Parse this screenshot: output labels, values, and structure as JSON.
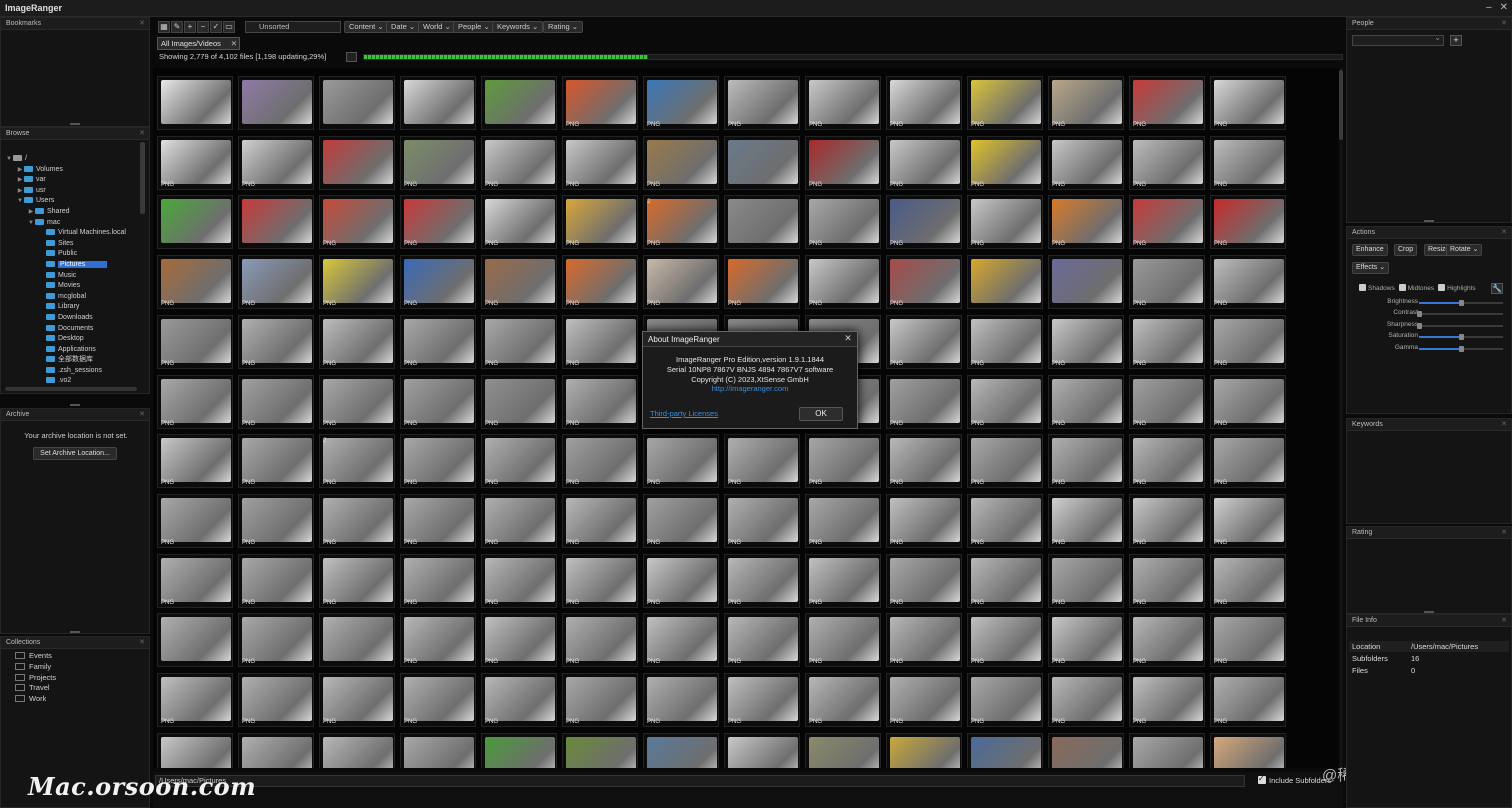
{
  "app": {
    "title": "ImageRanger"
  },
  "panels": {
    "bookmarks": "Bookmarks",
    "browse": "Browse",
    "archive": "Archive",
    "collections": "Collections",
    "people": "People",
    "actions": "Actions",
    "keywords": "Keywords",
    "rating": "Rating",
    "file_info": "File Info"
  },
  "tree": [
    {
      "label": "/",
      "depth": 0,
      "expanded": true,
      "drive": true
    },
    {
      "label": "Volumes",
      "depth": 1,
      "expanded": false
    },
    {
      "label": "var",
      "depth": 1,
      "expanded": false
    },
    {
      "label": "usr",
      "depth": 1,
      "expanded": false
    },
    {
      "label": "Users",
      "depth": 1,
      "expanded": true
    },
    {
      "label": "Shared",
      "depth": 2,
      "expanded": false
    },
    {
      "label": "mac",
      "depth": 2,
      "expanded": true
    },
    {
      "label": "Virtual Machines.local",
      "depth": 3
    },
    {
      "label": "Sites",
      "depth": 3
    },
    {
      "label": "Public",
      "depth": 3
    },
    {
      "label": "Pictures",
      "depth": 3,
      "selected": true
    },
    {
      "label": "Music",
      "depth": 3
    },
    {
      "label": "Movies",
      "depth": 3
    },
    {
      "label": "mcglobal",
      "depth": 3
    },
    {
      "label": "Library",
      "depth": 3
    },
    {
      "label": "Downloads",
      "depth": 3
    },
    {
      "label": "Documents",
      "depth": 3
    },
    {
      "label": "Desktop",
      "depth": 3
    },
    {
      "label": "Applications",
      "depth": 3
    },
    {
      "label": "全部数据库",
      "depth": 3
    },
    {
      "label": ".zsh_sessions",
      "depth": 3
    },
    {
      "label": ".vo2",
      "depth": 3
    }
  ],
  "archive": {
    "message": "Your archive location is not set.",
    "button": "Set Archive Location..."
  },
  "collections": [
    "Events",
    "Family",
    "Projects",
    "Travel",
    "Work"
  ],
  "toolbar": {
    "sort_value": "Unsorted",
    "filters": [
      "Content",
      "Date",
      "World",
      "People",
      "Keywords",
      "Rating"
    ],
    "tab_label": "All Images/Videos",
    "status": "Showing 2,779 of 4,102 files [1,198 updating,29%]",
    "progress": 0.29
  },
  "grid": {
    "rows": [
      [
        {
          "tag": "",
          "c": "#e8e8e8"
        },
        {
          "tag": "",
          "c": "#8e7aa6"
        },
        {
          "tag": "",
          "c": "#9a9a9a"
        },
        {
          "tag": "",
          "c": "#d8d8d8"
        },
        {
          "tag": "",
          "c": "#5e9a3c"
        },
        {
          "tag": "PNG",
          "c": "#d8572a"
        },
        {
          "tag": "PNG",
          "c": "#3a78b8"
        },
        {
          "tag": "PNG",
          "c": "#bdbdbd"
        },
        {
          "tag": "PNG",
          "c": "#c9c9c9"
        },
        {
          "tag": "PNG",
          "c": "#d8d8d8"
        },
        {
          "tag": "PNG",
          "c": "#d9c43a"
        },
        {
          "tag": "PNG",
          "c": "#b8a78a"
        },
        {
          "tag": "PNG",
          "c": "#c83a3a"
        },
        {
          "tag": "PNG",
          "c": "#d8d8d8"
        }
      ],
      [
        {
          "tag": "PNG",
          "c": "#e0e0e0"
        },
        {
          "tag": "PNG",
          "c": "#d0d0d0"
        },
        {
          "tag": "",
          "c": "#c23b3b"
        },
        {
          "tag": "PNG",
          "c": "#7c8c6a"
        },
        {
          "tag": "PNG",
          "c": "#c8c8c8"
        },
        {
          "tag": "PNG",
          "c": "#c8c8c8"
        },
        {
          "tag": "PNG",
          "c": "#9a7a4a"
        },
        {
          "tag": "",
          "c": "#6a7a8c"
        },
        {
          "tag": "PNG",
          "c": "#a82a2a"
        },
        {
          "tag": "PNG",
          "c": "#c8c8c8"
        },
        {
          "tag": "PNG",
          "c": "#e0c22a"
        },
        {
          "tag": "PNG",
          "c": "#c8c8c8"
        },
        {
          "tag": "PNG",
          "c": "#bdbdbd"
        },
        {
          "tag": "PNG",
          "c": "#bdbdbd"
        }
      ],
      [
        {
          "tag": "",
          "c": "#4aa83a"
        },
        {
          "tag": "",
          "c": "#c83a3a"
        },
        {
          "tag": "PNG",
          "c": "#c84a3a"
        },
        {
          "tag": "PNG",
          "c": "#c83a3a"
        },
        {
          "tag": "PNG",
          "c": "#d8d8d8"
        },
        {
          "tag": "PNG",
          "c": "#d8a83a"
        },
        {
          "tag": "PNG",
          "c": "#d86a2a",
          "ct": "2"
        },
        {
          "tag": "",
          "c": "#8a8a8a"
        },
        {
          "tag": "PNG",
          "c": "#a8a8a8"
        },
        {
          "tag": "PNG",
          "c": "#4a5a8a"
        },
        {
          "tag": "PNG",
          "c": "#c8c8c8"
        },
        {
          "tag": "PNG",
          "c": "#d87a2a"
        },
        {
          "tag": "PNG",
          "c": "#c83a3a"
        },
        {
          "tag": "PNG",
          "c": "#c82a2a"
        }
      ],
      [
        {
          "tag": "PNG",
          "c": "#a86a3a"
        },
        {
          "tag": "PNG",
          "c": "#8a9ab8"
        },
        {
          "tag": "PNG",
          "c": "#d8c83a"
        },
        {
          "tag": "PNG",
          "c": "#3a6ab8"
        },
        {
          "tag": "PNG",
          "c": "#9a6a4a"
        },
        {
          "tag": "PNG",
          "c": "#d86a2a"
        },
        {
          "tag": "PNG",
          "c": "#c8b8a8"
        },
        {
          "tag": "PNG",
          "c": "#d86a2a"
        },
        {
          "tag": "PNG",
          "c": "#c8c8c8"
        },
        {
          "tag": "PNG",
          "c": "#a84a4a"
        },
        {
          "tag": "",
          "c": "#d8a82a"
        },
        {
          "tag": "",
          "c": "#6a6a9a"
        },
        {
          "tag": "PNG",
          "c": "#9a9a9a"
        },
        {
          "tag": "PNG",
          "c": "#bdbdbd"
        }
      ],
      [
        {
          "tag": "PNG",
          "c": "#9a9a9a"
        },
        {
          "tag": "PNG",
          "c": "#b0b0b0"
        },
        {
          "tag": "PNG",
          "c": "#bdbdbd"
        },
        {
          "tag": "PNG",
          "c": "#a8a8a8"
        },
        {
          "tag": "PNG",
          "c": "#a8a8a8"
        },
        {
          "tag": "PNG",
          "c": "#c0c0c0"
        },
        {
          "tag": "",
          "c": "#8a8a8a"
        },
        {
          "tag": "",
          "c": "#8a8a8a"
        },
        {
          "tag": "",
          "c": "#8a8a8a"
        },
        {
          "tag": "PNG",
          "c": "#c8c8c8"
        },
        {
          "tag": "PNG",
          "c": "#c0c0c0"
        },
        {
          "tag": "PNG",
          "c": "#c8c8c8"
        },
        {
          "tag": "PNG",
          "c": "#c0c0c0"
        },
        {
          "tag": "PNG",
          "c": "#a8a8a8"
        }
      ],
      [
        {
          "tag": "PNG",
          "c": "#a8a8a8"
        },
        {
          "tag": "PNG",
          "c": "#a0a0a0"
        },
        {
          "tag": "PNG",
          "c": "#a8a8a8"
        },
        {
          "tag": "PNG",
          "c": "#a0a0a0"
        },
        {
          "tag": "PNG",
          "c": "#909090"
        },
        {
          "tag": "PNG",
          "c": "#b0b0b0"
        },
        {
          "tag": "",
          "c": "#8a8a8a"
        },
        {
          "tag": "",
          "c": "#8a8a8a"
        },
        {
          "tag": "",
          "c": "#8a8a8a"
        },
        {
          "tag": "PNG",
          "c": "#a0a0a0"
        },
        {
          "tag": "PNG",
          "c": "#b8b8b8"
        },
        {
          "tag": "PNG",
          "c": "#b0b0b0"
        },
        {
          "tag": "PNG",
          "c": "#a0a0a0"
        },
        {
          "tag": "PNG",
          "c": "#a8a8a8"
        }
      ],
      [
        {
          "tag": "PNG",
          "c": "#c8c8c8"
        },
        {
          "tag": "PNG",
          "c": "#a8a8a8"
        },
        {
          "tag": "PNG",
          "c": "#b0b0b0",
          "ct": "2"
        },
        {
          "tag": "PNG",
          "c": "#a8a8a8"
        },
        {
          "tag": "PNG",
          "c": "#b0b0b0"
        },
        {
          "tag": "PNG",
          "c": "#a0a0a0"
        },
        {
          "tag": "PNG",
          "c": "#a8a8a8"
        },
        {
          "tag": "PNG",
          "c": "#b0b0b0"
        },
        {
          "tag": "PNG",
          "c": "#a8a8a8"
        },
        {
          "tag": "PNG",
          "c": "#b8b8b8"
        },
        {
          "tag": "PNG",
          "c": "#a8a8a8"
        },
        {
          "tag": "PNG",
          "c": "#b0b0b0"
        },
        {
          "tag": "PNG",
          "c": "#b8b8b8"
        },
        {
          "tag": "PNG",
          "c": "#a8a8a8"
        }
      ],
      [
        {
          "tag": "PNG",
          "c": "#a8a8a8"
        },
        {
          "tag": "PNG",
          "c": "#a0a0a0"
        },
        {
          "tag": "PNG",
          "c": "#b0b0b0"
        },
        {
          "tag": "PNG",
          "c": "#a8a8a8"
        },
        {
          "tag": "PNG",
          "c": "#b0b0b0"
        },
        {
          "tag": "PNG",
          "c": "#b8b8b8"
        },
        {
          "tag": "PNG",
          "c": "#a0a0a0"
        },
        {
          "tag": "PNG",
          "c": "#b0b0b0"
        },
        {
          "tag": "PNG",
          "c": "#a8a8a8"
        },
        {
          "tag": "PNG",
          "c": "#c0c0c0"
        },
        {
          "tag": "PNG",
          "c": "#b8b8b8"
        },
        {
          "tag": "PNG",
          "c": "#d0d0d0"
        },
        {
          "tag": "PNG",
          "c": "#c8c8c8"
        },
        {
          "tag": "PNG",
          "c": "#d0d0d0"
        }
      ],
      [
        {
          "tag": "PNG",
          "c": "#b0b0b0"
        },
        {
          "tag": "PNG",
          "c": "#a8a8a8"
        },
        {
          "tag": "PNG",
          "c": "#c0c0c0"
        },
        {
          "tag": "PNG",
          "c": "#b0b0b0"
        },
        {
          "tag": "PNG",
          "c": "#b8b8b8"
        },
        {
          "tag": "PNG",
          "c": "#c0c0c0"
        },
        {
          "tag": "PNG",
          "c": "#c8c8c8"
        },
        {
          "tag": "PNG",
          "c": "#b8b8b8"
        },
        {
          "tag": "PNG",
          "c": "#c0c0c0"
        },
        {
          "tag": "PNG",
          "c": "#a8a8a8"
        },
        {
          "tag": "PNG",
          "c": "#b8b8b8"
        },
        {
          "tag": "PNG",
          "c": "#a8a8a8"
        },
        {
          "tag": "PNG",
          "c": "#b0b0b0"
        },
        {
          "tag": "PNG",
          "c": "#b8b8b8"
        }
      ],
      [
        {
          "tag": "",
          "c": "#b0b0b0"
        },
        {
          "tag": "PNG",
          "c": "#a8a8a8"
        },
        {
          "tag": "",
          "c": "#b0b0b0"
        },
        {
          "tag": "PNG",
          "c": "#b8b8b8"
        },
        {
          "tag": "PNG",
          "c": "#c0c0c0"
        },
        {
          "tag": "PNG",
          "c": "#b0b0b0"
        },
        {
          "tag": "PNG",
          "c": "#c0c0c0"
        },
        {
          "tag": "PNG",
          "c": "#b8b8b8"
        },
        {
          "tag": "PNG",
          "c": "#b0b0b0"
        },
        {
          "tag": "PNG",
          "c": "#b8b8b8"
        },
        {
          "tag": "PNG",
          "c": "#c0c0c0"
        },
        {
          "tag": "PNG",
          "c": "#c8c8c8"
        },
        {
          "tag": "PNG",
          "c": "#b8b8b8"
        },
        {
          "tag": "PNG",
          "c": "#a8a8a8"
        }
      ],
      [
        {
          "tag": "PNG",
          "c": "#c0c0c0"
        },
        {
          "tag": "PNG",
          "c": "#b0b0b0"
        },
        {
          "tag": "PNG",
          "c": "#b8b8b8"
        },
        {
          "tag": "PNG",
          "c": "#b0b0b0"
        },
        {
          "tag": "PNG",
          "c": "#b8b8b8"
        },
        {
          "tag": "PNG",
          "c": "#a8a8a8"
        },
        {
          "tag": "PNG",
          "c": "#b0b0b0"
        },
        {
          "tag": "PNG",
          "c": "#c0c0c0"
        },
        {
          "tag": "PNG",
          "c": "#b8b8b8"
        },
        {
          "tag": "PNG",
          "c": "#b0b0b0"
        },
        {
          "tag": "PNG",
          "c": "#a8a8a8"
        },
        {
          "tag": "PNG",
          "c": "#b8b8b8"
        },
        {
          "tag": "PNG",
          "c": "#c0c0c0"
        },
        {
          "tag": "PNG",
          "c": "#b0b0b0"
        }
      ],
      [
        {
          "tag": "",
          "c": "#c8c8c8"
        },
        {
          "tag": "",
          "c": "#b0b0b0"
        },
        {
          "tag": "",
          "c": "#b8b8b8"
        },
        {
          "tag": "",
          "c": "#a8a8a8"
        },
        {
          "tag": "",
          "c": "#4a9a3a"
        },
        {
          "tag": "",
          "c": "#6a8a3a"
        },
        {
          "tag": "",
          "c": "#5a7a9a"
        },
        {
          "tag": "",
          "c": "#c8c8c8"
        },
        {
          "tag": "",
          "c": "#8a8a6a"
        },
        {
          "tag": "",
          "c": "#c8a83a"
        },
        {
          "tag": "",
          "c": "#4a6a9a"
        },
        {
          "tag": "",
          "c": "#8a6a5a"
        },
        {
          "tag": "",
          "c": "#a8a8a8"
        },
        {
          "tag": "",
          "c": "#d8a87a"
        }
      ]
    ]
  },
  "path_bar": "/Users/mac/Pictures",
  "include_subfolders": "Include Subfolders",
  "watermark_left": "Mac.orsoon.com",
  "watermark_right": "@稀土掘金技术社区",
  "actions": {
    "buttons": [
      "Enhance",
      "Crop",
      "Resize",
      "Rotate"
    ],
    "effects": "Effects",
    "checks": [
      "Shadows",
      "Midtones",
      "Highlights"
    ],
    "sliders": [
      {
        "label": "Brightness",
        "value": 0.5
      },
      {
        "label": "Contrast",
        "value": 0
      },
      {
        "label": "Sharpness",
        "value": 0
      },
      {
        "label": "Saturation",
        "value": 0.5
      },
      {
        "label": "Gamma",
        "value": 0.5
      }
    ]
  },
  "file_info": [
    {
      "k": "Location",
      "v": "/Users/mac/Pictures"
    },
    {
      "k": "Subfolders",
      "v": "16"
    },
    {
      "k": "Files",
      "v": "0"
    }
  ],
  "dialog": {
    "title": "About ImageRanger",
    "lines": [
      "ImageRanger Pro Edition,version 1.9.1.1844",
      "Serial 10NP8 7867V BNJS 4894 7867V7 software",
      "Copyright (C) 2023,XtSense GmbH"
    ],
    "link": "http://imageranger.com",
    "third_party": "Third-party Licenses",
    "ok": "OK"
  },
  "colors": {
    "accent": "#2f6fd4",
    "progress": "#3ec23e",
    "link": "#3b8de0"
  }
}
